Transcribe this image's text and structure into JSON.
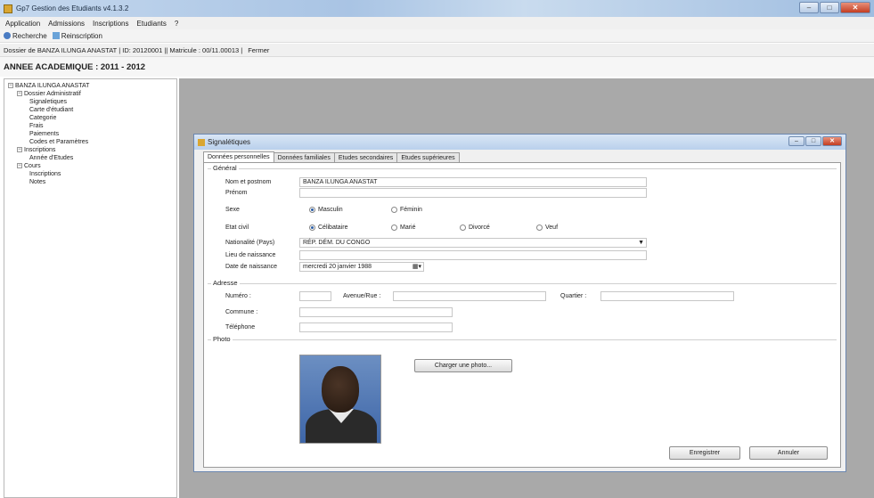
{
  "window": {
    "title": "Gp7 Gestion des Etudiants  v4.1.3.2"
  },
  "menu": [
    "Application",
    "Admissions",
    "Inscriptions",
    "Etudiants",
    "?"
  ],
  "toolbar": {
    "search_label": "Recherche",
    "reinscription_label": "Reinscription"
  },
  "infobar": {
    "dossier_text": "Dossier de BANZA ILUNGA ANASTAT  |  ID: 20120001 || Matricule : 00/11.00013  |",
    "close_label": "Fermer"
  },
  "year_banner": "ANNEE ACADEMIQUE : 2011 - 2012",
  "tree": {
    "root": "BANZA ILUNGA ANASTAT",
    "admin": "Dossier Administratif",
    "admin_children": [
      "Signaletiques",
      "Carte d'étudiant",
      "Categorie",
      "Frais",
      "Paiements",
      "Codes et Paramètres"
    ],
    "inscriptions": "Inscriptions",
    "inscriptions_children": [
      "Année d'Etudes"
    ],
    "cours": "Cours",
    "cours_children": [
      "Inscriptions",
      "Notes"
    ]
  },
  "child": {
    "title": "Signalétiques",
    "tabs": [
      "Données personnelles",
      "Données familiales",
      "Etudes secondaires",
      "Etudes supérieures"
    ],
    "general_label": "Général",
    "fields": {
      "nom_label": "Nom et postnom",
      "nom_value": "BANZA ILUNGA ANASTAT",
      "prenom_label": "Prénom",
      "prenom_value": "",
      "sexe_label": "Sexe",
      "sexe_options": [
        "Masculin",
        "Féminin"
      ],
      "etat_label": "Etat civil",
      "etat_options": [
        "Célibataire",
        "Marié",
        "Divorcé",
        "Veuf"
      ],
      "nationalite_label": "Nationalité (Pays)",
      "nationalite_value": "RÉP. DÉM. DU CONGO",
      "lieu_label": "Lieu de naissance",
      "date_label": "Date de naissance",
      "date_value": "mercredi  20  janvier  1988"
    },
    "adresse_label": "Adresse",
    "adresse": {
      "numero_label": "Numéro :",
      "avenue_label": "Avenue/Rue :",
      "quartier_label": "Quartier :",
      "commune_label": "Commune :",
      "telephone_label": "Téléphone"
    },
    "photo_label": "Photo",
    "change_photo_label": "Charger une photo...",
    "save_label": "Enregistrer",
    "cancel_label": "Annuler"
  }
}
